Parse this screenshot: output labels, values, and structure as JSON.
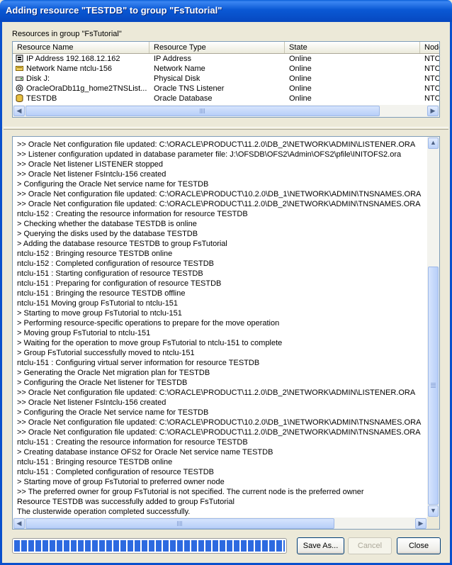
{
  "window": {
    "title": "Adding resource \"TESTDB\" to group \"FsTutorial\""
  },
  "resources": {
    "label": "Resources in group \"FsTutorial\"",
    "columns": [
      "Resource Name",
      "Resource Type",
      "State",
      "Node"
    ],
    "rows": [
      {
        "icon": "ip-address-icon",
        "name": "IP Address 192.168.12.162",
        "type": "IP Address",
        "state": "Online",
        "node": "NTC"
      },
      {
        "icon": "network-name-icon",
        "name": "Network Name ntclu-156",
        "type": "Network Name",
        "state": "Online",
        "node": "NTC"
      },
      {
        "icon": "disk-icon",
        "name": "Disk J:",
        "type": "Physical Disk",
        "state": "Online",
        "node": "NTC"
      },
      {
        "icon": "tns-listener-icon",
        "name": "OracleOraDb11g_home2TNSList...",
        "type": "Oracle TNS Listener",
        "state": "Online",
        "node": "NTC"
      },
      {
        "icon": "database-icon",
        "name": "TESTDB",
        "type": "Oracle Database",
        "state": "Online",
        "node": "NTC"
      }
    ]
  },
  "log": {
    "lines": [
      ">> Oracle Net configuration file updated: C:\\ORACLE\\PRODUCT\\11.2.0\\DB_2\\NETWORK\\ADMIN\\LISTENER.ORA",
      ">> Listener configuration updated in database parameter file: J:\\OFSDB\\OFS2\\Admin\\OFS2\\pfile\\INITOFS2.ora",
      ">> Oracle Net listener LISTENER stopped",
      ">> Oracle Net listener FsIntclu-156 created",
      "> Configuring the Oracle Net service name for TESTDB",
      ">> Oracle Net configuration file updated: C:\\ORACLE\\PRODUCT\\10.2.0\\DB_1\\NETWORK\\ADMIN\\TNSNAMES.ORA",
      ">> Oracle Net configuration file updated: C:\\ORACLE\\PRODUCT\\11.2.0\\DB_2\\NETWORK\\ADMIN\\TNSNAMES.ORA",
      "ntclu-152 : Creating the resource information for resource TESTDB",
      "> Checking whether the database TESTDB is online",
      "> Querying the disks used by the database TESTDB",
      "> Adding the database resource TESTDB to group FsTutorial",
      "ntclu-152 : Bringing resource TESTDB online",
      "ntclu-152 : Completed configuration of resource TESTDB",
      "ntclu-151 : Starting configuration of resource TESTDB",
      "ntclu-151 : Preparing for configuration of resource TESTDB",
      "ntclu-151 : Bringing the resource TESTDB offline",
      "ntclu-151 Moving group FsTutorial to ntclu-151",
      "> Starting to move group FsTutorial to ntclu-151",
      "> Performing resource-specific operations to prepare for the move operation",
      "> Moving group FsTutorial to ntclu-151",
      "> Waiting for the operation to move group FsTutorial to ntclu-151 to complete",
      "> Group FsTutorial successfully moved to ntclu-151",
      "ntclu-151 : Configuring virtual server information for resource TESTDB",
      "> Generating the Oracle Net migration plan for TESTDB",
      "> Configuring the Oracle Net listener for TESTDB",
      ">> Oracle Net configuration file updated: C:\\ORACLE\\PRODUCT\\11.2.0\\DB_2\\NETWORK\\ADMIN\\LISTENER.ORA",
      ">> Oracle Net listener FsIntclu-156 created",
      "> Configuring the Oracle Net service name for TESTDB",
      ">> Oracle Net configuration file updated: C:\\ORACLE\\PRODUCT\\10.2.0\\DB_1\\NETWORK\\ADMIN\\TNSNAMES.ORA",
      ">> Oracle Net configuration file updated: C:\\ORACLE\\PRODUCT\\11.2.0\\DB_2\\NETWORK\\ADMIN\\TNSNAMES.ORA",
      "ntclu-151 : Creating the resource information for resource TESTDB",
      "> Creating database instance OFS2 for Oracle Net service name TESTDB",
      "ntclu-151 : Bringing resource TESTDB online",
      "ntclu-151 : Completed configuration of resource TESTDB",
      "> Starting move of group FsTutorial to preferred owner node",
      ">> The preferred owner for group FsTutorial is not specified. The current node is the preferred owner",
      "Resource TESTDB was successfully added to group FsTutorial",
      "The clusterwide operation completed successfully."
    ]
  },
  "progress": {
    "fraction": 1.0
  },
  "buttons": {
    "save_as": "Save As...",
    "cancel": "Cancel",
    "close": "Close"
  },
  "colors": {
    "titlebar": "#0a58d4",
    "progress": "#2d6ae0",
    "border": "#7f9db9"
  },
  "arrows": {
    "left": "◀",
    "right": "▶",
    "up": "▲",
    "down": "▼"
  }
}
